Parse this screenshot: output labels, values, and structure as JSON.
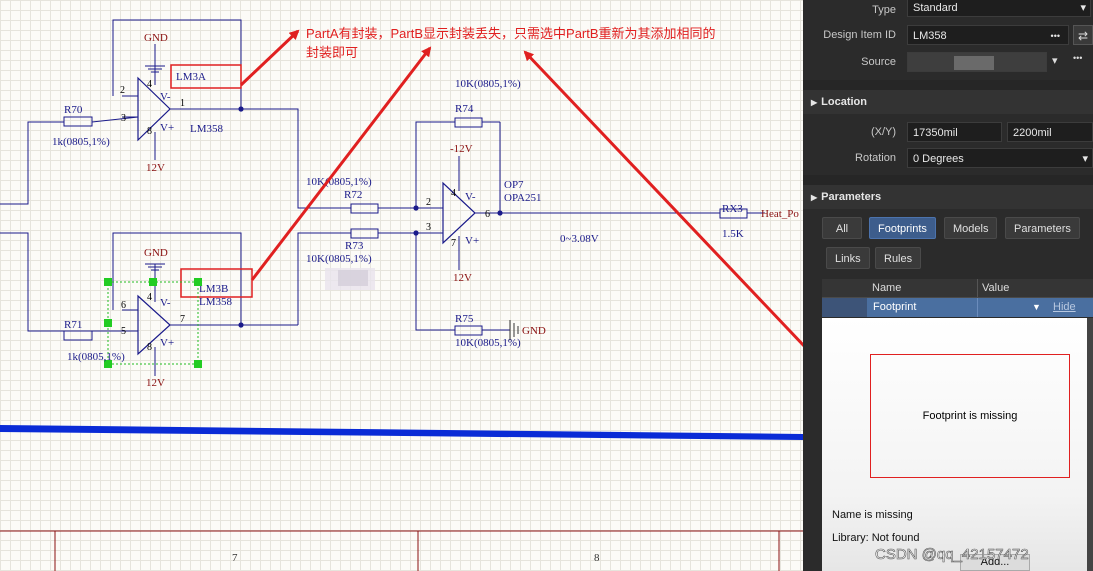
{
  "schematic": {
    "annotation": {
      "line1": "PartA有封装，PartB显示封装丢失，只需选中PartB重新为其添加相同的",
      "line2": "封装即可"
    },
    "u_a": {
      "designator": "LM3A",
      "value": "LM358",
      "pin_inv": "2",
      "pin_noninv": "3",
      "pin_out": "1",
      "pin_vpos": "4",
      "pin_vneg": "8",
      "label_vm": "V-",
      "label_vp": "V+"
    },
    "u_b": {
      "designator": "LM3B",
      "value": "LM358",
      "pin_inv": "6",
      "pin_noninv": "5",
      "pin_out": "7",
      "pin_vpos": "4",
      "pin_vneg": "8",
      "label_vm": "V-",
      "label_vp": "V+"
    },
    "op7": {
      "designator": "OP7",
      "value": "OPA251",
      "pin_inv": "2",
      "pin_noninv": "3",
      "pin_out": "6",
      "pin_vpos": "4",
      "pin_vneg": "7",
      "label_vm": "V-",
      "label_vp": "V+"
    },
    "power": {
      "gnd": "GND",
      "v12": "12V",
      "vneg12": "-12V"
    },
    "r70": {
      "designator": "R70",
      "value": "1k(0805,1%)"
    },
    "r71": {
      "designator": "R71",
      "value": "1k(0805,1%)"
    },
    "r72": {
      "designator": "R72",
      "value": "10K(0805,1%)"
    },
    "r73": {
      "designator": "R73",
      "value": "10K(0805,1%)"
    },
    "r74": {
      "designator": "R74",
      "value": "10K(0805,1%)"
    },
    "r75": {
      "designator": "R75",
      "value": "10K(0805,1%)"
    },
    "rx3": {
      "designator": "RX3",
      "value": "1.5K"
    },
    "net_heat": "Heat_Po",
    "range_note": "0~3.08V",
    "border_cols": [
      "7",
      "8"
    ],
    "watermark": "CSDN @qq_42157472"
  },
  "panel": {
    "type_label": "Type",
    "type_value": "Standard",
    "design_item_label": "Design Item ID",
    "design_item_value": "LM358",
    "more_glyph": "•••",
    "swap_glyph": "⇄",
    "source_label": "Source",
    "location_header": "Location",
    "xy_label": "(X/Y)",
    "x_value": "17350mil",
    "y_value": "2200mil",
    "rotation_label": "Rotation",
    "rotation_value": "0 Degrees",
    "parameters_header": "Parameters",
    "tabs": [
      "All",
      "Footprints",
      "Models",
      "Parameters",
      "Links",
      "Rules"
    ],
    "grid_col_name": "Name",
    "grid_col_value": "Value",
    "row_name": "Footprint",
    "row_action": "Hide",
    "preview_message": "Footprint is missing",
    "name_status": "Name is missing",
    "library_status": "Library:  Not found",
    "add_button": "Add..."
  },
  "colors": {
    "wire": "#1a1a8a",
    "annotation": "#e02020",
    "panel_bg": "#2b2b2b",
    "selected_tab": "#3d5d8c",
    "bus": "#0a2bd6"
  }
}
